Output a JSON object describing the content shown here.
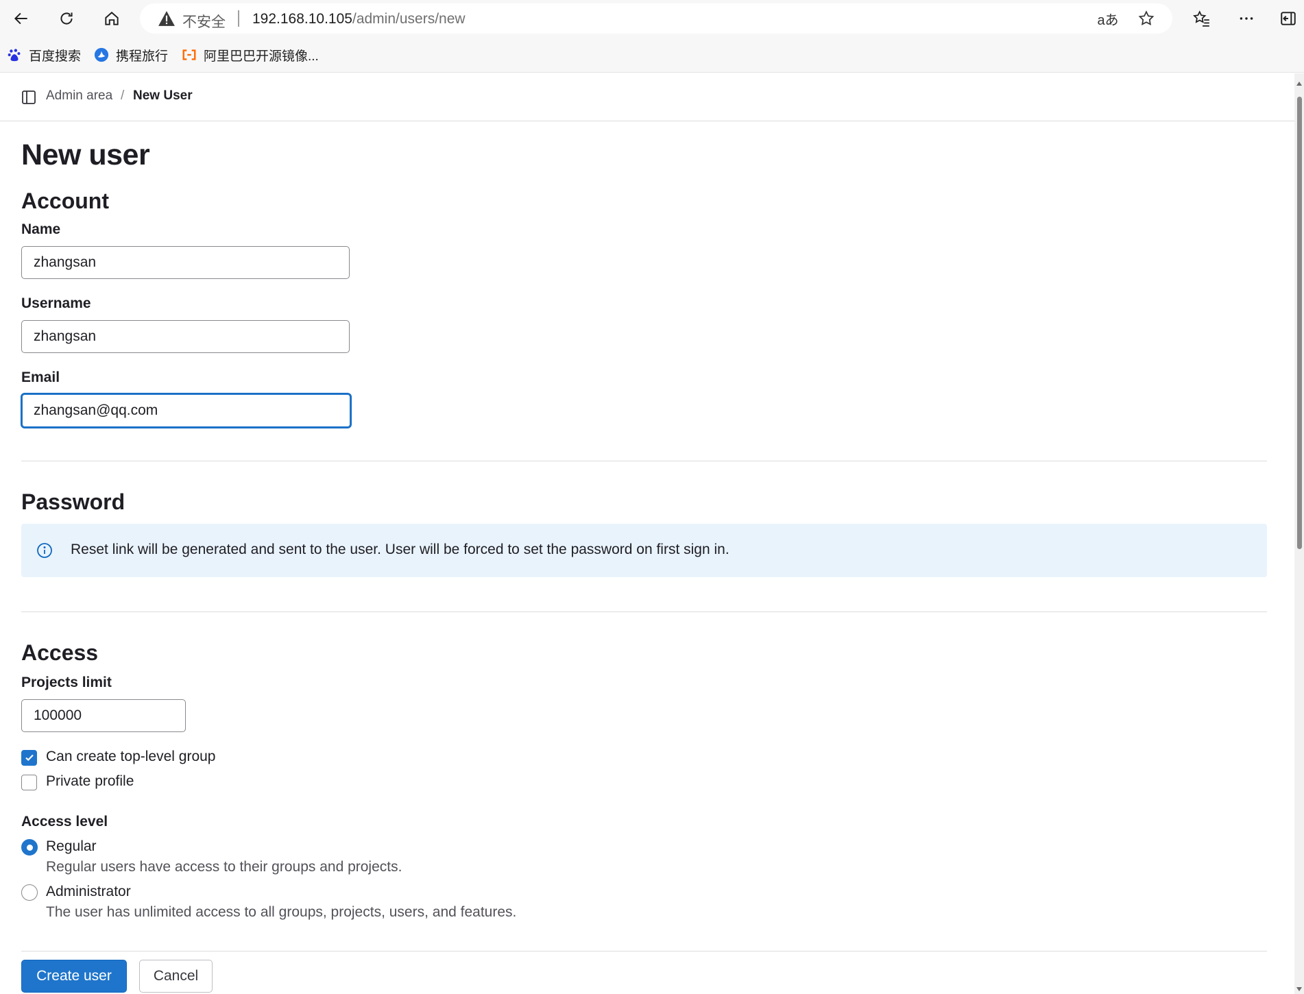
{
  "browser": {
    "insecure_label": "不安全",
    "url_host": "192.168.10.105",
    "url_path": "/admin/users/new",
    "bookmarks": [
      {
        "label": "百度搜索",
        "icon": "baidu-icon"
      },
      {
        "label": "携程旅行",
        "icon": "ctrip-icon"
      },
      {
        "label": "阿里巴巴开源镜像...",
        "icon": "alibaba-icon"
      }
    ],
    "read_aloud_glyph": "aあ"
  },
  "breadcrumb": {
    "parent": "Admin area",
    "separator": "/",
    "current": "New User"
  },
  "page": {
    "title": "New user"
  },
  "account": {
    "heading": "Account",
    "name_label": "Name",
    "name_value": "zhangsan",
    "username_label": "Username",
    "username_value": "zhangsan",
    "email_label": "Email",
    "email_value": "zhangsan@qq.com"
  },
  "password": {
    "heading": "Password",
    "alert_text": "Reset link will be generated and sent to the user. User will be forced to set the password on first sign in."
  },
  "access": {
    "heading": "Access",
    "projects_limit_label": "Projects limit",
    "projects_limit_value": "100000",
    "can_create_group_label": "Can create top-level group",
    "can_create_group_checked": true,
    "private_profile_label": "Private profile",
    "private_profile_checked": false,
    "access_level_label": "Access level",
    "levels": [
      {
        "label": "Regular",
        "help": "Regular users have access to their groups and projects.",
        "selected": true
      },
      {
        "label": "Administrator",
        "help": "The user has unlimited access to all groups, projects, users, and features.",
        "selected": false
      }
    ]
  },
  "actions": {
    "create_label": "Create user",
    "cancel_label": "Cancel"
  },
  "colors": {
    "primary": "#1f75cb",
    "alert_bg": "#e9f3fc",
    "text": "#1f1e24"
  }
}
